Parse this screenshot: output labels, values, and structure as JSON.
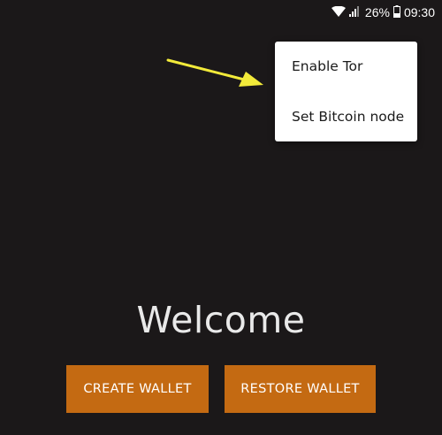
{
  "status_bar": {
    "wifi_icon": "wifi-icon",
    "signal_icon": "signal-icon",
    "battery_percent": "26%",
    "battery_icon": "battery-icon",
    "time": "09:30"
  },
  "overflow_menu": {
    "items": [
      {
        "label": "Enable Tor"
      },
      {
        "label": "Set Bitcoin node"
      }
    ]
  },
  "main": {
    "welcome_title": "Welcome",
    "create_wallet_label": "CREATE WALLET",
    "restore_wallet_label": "RESTORE WALLET"
  },
  "annotation": {
    "arrow_color": "#f2ea3a"
  },
  "colors": {
    "background": "#1b1819",
    "accent_button": "#c46a12",
    "menu_background": "#ffffff"
  }
}
